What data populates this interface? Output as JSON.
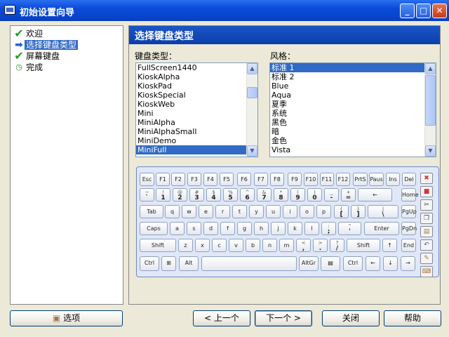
{
  "window": {
    "title": "初始设置向导"
  },
  "steps": [
    {
      "label": "欢迎",
      "icon": "check-icon"
    },
    {
      "label": "选择键盘类型",
      "icon": "arrow-right-icon",
      "selected": true
    },
    {
      "label": "屏幕键盘",
      "icon": "check-icon"
    },
    {
      "label": "完成",
      "icon": "clock-icon"
    }
  ],
  "content": {
    "header": "选择键盘类型",
    "keyboard_type_label": "键盘类型：",
    "style_label": "风格：",
    "keyboard_types": [
      "FullScreen1440",
      "KioskAlpha",
      "KioskPad",
      "KioskSpecial",
      "KioskWeb",
      "Mini",
      "MiniAlpha",
      "MiniAlphaSmall",
      "MiniDemo",
      "MiniFull"
    ],
    "keyboard_type_selected": "MiniFull",
    "styles": [
      "标准 1",
      "标准 2",
      "Blue",
      "Aqua",
      "夏季",
      "系统",
      "黑色",
      "暗",
      "金色",
      "Vista"
    ],
    "style_selected": "标准 1"
  },
  "keyboard": {
    "rows": [
      [
        [
          "",
          "Esc"
        ],
        [
          "",
          "F1"
        ],
        [
          "",
          "F2"
        ],
        [
          "",
          "F3"
        ],
        [
          "",
          "F4"
        ],
        [
          "",
          "F5"
        ],
        [
          "",
          "F6"
        ],
        [
          "",
          "F7"
        ],
        [
          "",
          "F8"
        ],
        [
          "",
          "F9"
        ],
        [
          "",
          "F10"
        ],
        [
          "",
          "F11"
        ],
        [
          "",
          "F12"
        ],
        [
          "",
          "PrtS"
        ],
        [
          "",
          "Paus"
        ],
        [
          "",
          "Ins"
        ],
        [
          "",
          "Del"
        ]
      ],
      [
        [
          "~",
          "`"
        ],
        [
          "!",
          "1"
        ],
        [
          "@",
          "2"
        ],
        [
          "#",
          "3"
        ],
        [
          "$",
          "4"
        ],
        [
          "%",
          "5"
        ],
        [
          "^",
          "6"
        ],
        [
          "&",
          "7"
        ],
        [
          "*",
          "8"
        ],
        [
          "(",
          "9"
        ],
        [
          ")",
          "0"
        ],
        [
          "_",
          "-"
        ],
        [
          "+",
          "="
        ],
        [
          "",
          "←"
        ],
        [
          "",
          "Home"
        ]
      ],
      [
        [
          "",
          "Tab"
        ],
        [
          "",
          "q"
        ],
        [
          "",
          "w"
        ],
        [
          "",
          "e"
        ],
        [
          "",
          "r"
        ],
        [
          "",
          "t"
        ],
        [
          "",
          "y"
        ],
        [
          "",
          "u"
        ],
        [
          "",
          "i"
        ],
        [
          "",
          "o"
        ],
        [
          "",
          "p"
        ],
        [
          "{",
          "["
        ],
        [
          "}",
          "]"
        ],
        [
          "|",
          "\\"
        ],
        [
          "",
          "PgUp"
        ]
      ],
      [
        [
          "",
          "Caps"
        ],
        [
          "",
          "a"
        ],
        [
          "",
          "s"
        ],
        [
          "",
          "d"
        ],
        [
          "",
          "f"
        ],
        [
          "",
          "g"
        ],
        [
          "",
          "h"
        ],
        [
          "",
          "j"
        ],
        [
          "",
          "k"
        ],
        [
          "",
          "l"
        ],
        [
          ":",
          ";"
        ],
        [
          "\"",
          "'"
        ],
        [
          "",
          "Enter"
        ],
        [
          "",
          "PgDn"
        ]
      ],
      [
        [
          "",
          "Shift"
        ],
        [
          "",
          "z"
        ],
        [
          "",
          "x"
        ],
        [
          "",
          "c"
        ],
        [
          "",
          "v"
        ],
        [
          "",
          "b"
        ],
        [
          "",
          "n"
        ],
        [
          "",
          "m"
        ],
        [
          "<",
          ","
        ],
        [
          ">",
          "."
        ],
        [
          "?",
          "/"
        ],
        [
          "",
          "Shift"
        ],
        [
          "",
          "↑"
        ],
        [
          "",
          "End"
        ]
      ],
      [
        [
          "",
          "Ctrl"
        ],
        [
          "",
          "⊞"
        ],
        [
          "",
          "Alt"
        ],
        [
          "",
          ""
        ],
        [
          "",
          "AltGr"
        ],
        [
          "",
          "▤"
        ],
        [
          "",
          "Ctrl"
        ],
        [
          "",
          "←"
        ],
        [
          "",
          "↓"
        ],
        [
          "",
          "→"
        ]
      ]
    ],
    "side_icons": [
      "close-red-icon",
      "flag-icon",
      "cut-icon",
      "copy-icon",
      "paste-icon",
      "undo-icon",
      "settings-icon",
      "keyboard-settings-icon"
    ]
  },
  "buttons": {
    "options": "选项",
    "back": "< 上一个",
    "next": "下一个 >",
    "close": "关闭",
    "help": "帮助"
  }
}
